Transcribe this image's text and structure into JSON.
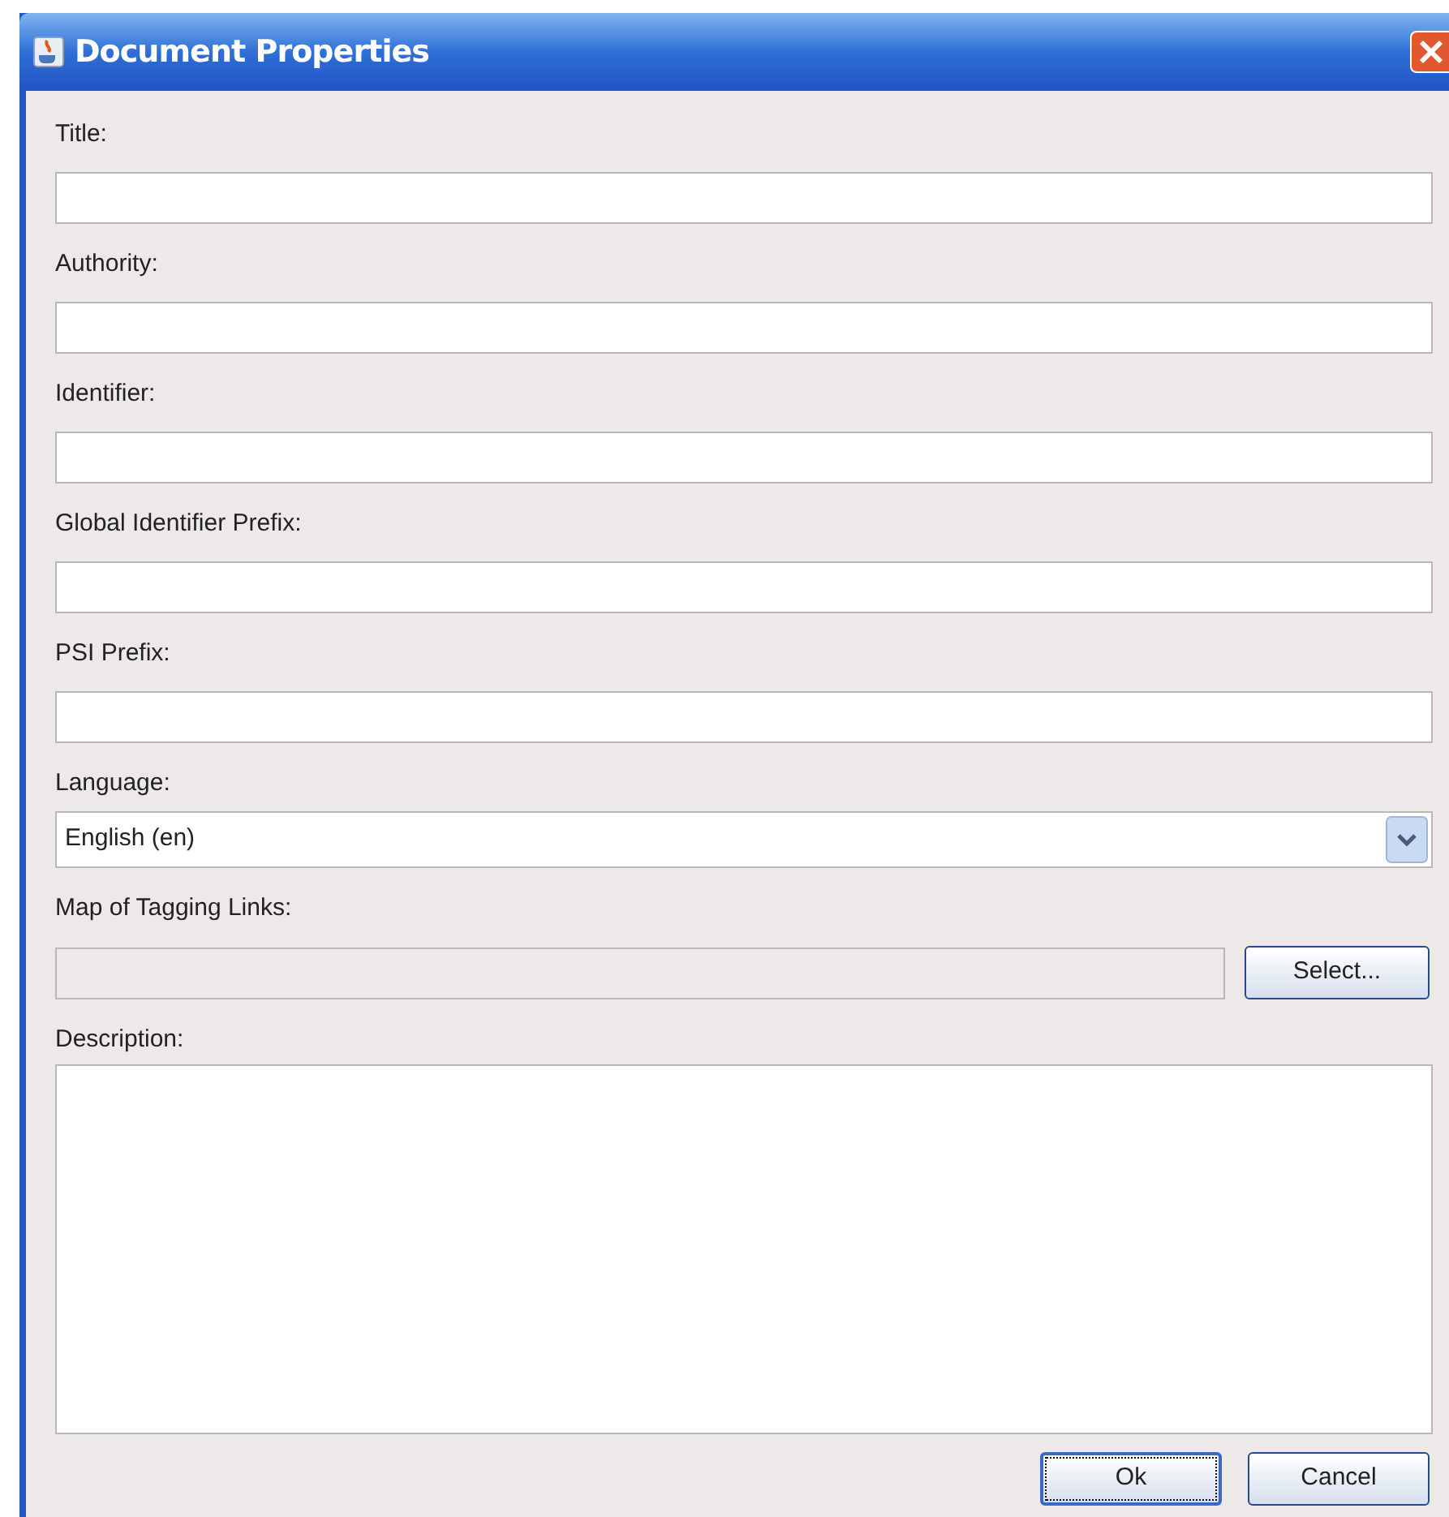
{
  "window": {
    "title": "Document Properties"
  },
  "fields": [
    {
      "kind": "text",
      "label": "Title:"
    },
    {
      "kind": "text",
      "label": "Authority:"
    },
    {
      "kind": "text",
      "label": "Identifier:"
    },
    {
      "kind": "text",
      "label": "Global Identifier Prefix:"
    },
    {
      "kind": "text",
      "label": "PSI Prefix:"
    },
    {
      "kind": "dropdown",
      "label": "Language:",
      "value": "English (en)"
    },
    {
      "kind": "picker",
      "label": "Map of Tagging Links:",
      "disabled": true,
      "button": "Select..."
    },
    {
      "kind": "textarea",
      "label": "Description:"
    }
  ],
  "buttons": [
    {
      "label": "Ok",
      "focused": true
    },
    {
      "label": "Cancel",
      "focused": false
    }
  ]
}
